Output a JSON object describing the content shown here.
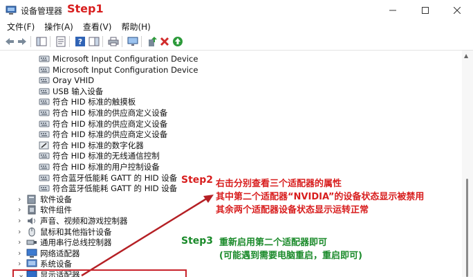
{
  "window": {
    "title": "设备管理器",
    "step1": "Step1"
  },
  "menu": [
    "文件(F)",
    "操作(A)",
    "查看(V)",
    "帮助(H)"
  ],
  "devices": [
    {
      "label": "Microsoft Input Configuration Device",
      "icon": "hid-device-icon"
    },
    {
      "label": "Microsoft Input Configuration Device",
      "icon": "hid-device-icon"
    },
    {
      "label": "Oray VHID",
      "icon": "hid-device-icon"
    },
    {
      "label": "USB 输入设备",
      "icon": "hid-device-icon"
    },
    {
      "label": "符合 HID 标准的触摸板",
      "icon": "hid-device-icon"
    },
    {
      "label": "符合 HID 标准的供应商定义设备",
      "icon": "hid-device-icon"
    },
    {
      "label": "符合 HID 标准的供应商定义设备",
      "icon": "hid-device-icon"
    },
    {
      "label": "符合 HID 标准的供应商定义设备",
      "icon": "hid-device-icon"
    },
    {
      "label": "符合 HID 标准的数字化器",
      "icon": "digitizer-icon"
    },
    {
      "label": "符合 HID 标准的无线通信控制",
      "icon": "hid-device-icon"
    },
    {
      "label": "符合 HID 标准的用户控制设备",
      "icon": "hid-device-icon"
    },
    {
      "label": "符合蓝牙低能耗 GATT 的 HID 设备",
      "icon": "hid-device-icon"
    },
    {
      "label": "符合蓝牙低能耗 GATT 的 HID 设备",
      "icon": "hid-device-icon"
    }
  ],
  "categories": [
    {
      "label": "软件设备",
      "icon": "software-device-icon"
    },
    {
      "label": "软件组件",
      "icon": "software-component-icon"
    },
    {
      "label": "声音、视频和游戏控制器",
      "icon": "speaker-icon"
    },
    {
      "label": "鼠标和其他指针设备",
      "icon": "mouse-icon"
    },
    {
      "label": "通用串行总线控制器",
      "icon": "usb-icon"
    },
    {
      "label": "网络适配器",
      "icon": "network-icon"
    },
    {
      "label": "系统设备",
      "icon": "system-device-icon"
    },
    {
      "label": "显示适配器",
      "icon": "display-adapter-icon"
    }
  ],
  "annotations": {
    "step2_label": "Step2",
    "step2_lines": [
      "右击分别查看三个适配器的属性",
      "其中第二个适配器“NVIDIA”的设备状态显示被禁用",
      "其余两个适配器设备状态显示运转正常"
    ],
    "step3_label": "Step3",
    "step3_lines": [
      "重新启用第二个适配器即可",
      "(可能遇到需要电脑重启，重启即可)"
    ]
  },
  "colors": {
    "step_red": "#d81e1e",
    "step_green": "#1a8a2a",
    "highlight": "#c8222a"
  }
}
